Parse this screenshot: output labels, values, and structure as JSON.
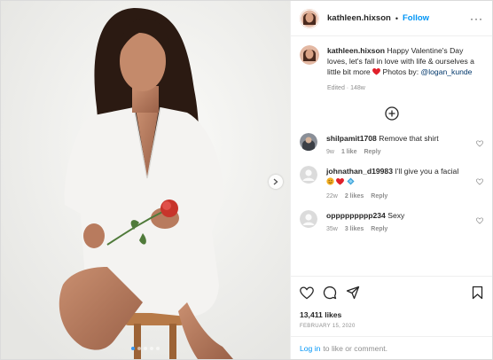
{
  "post": {
    "author": "kathleen.hixson",
    "separator": "•",
    "follow_label": "Follow",
    "more_icon": "more-horizontal-icon",
    "image_count": 5,
    "active_index": 0
  },
  "caption": {
    "author": "kathleen.hixson",
    "text": "Happy Valentine's Day loves, let's fall in love with life & ourselves a little bit more",
    "emoji": "red-heart",
    "photos_by": "Photos by:",
    "mention": "@logan_kunde",
    "meta": "Edited · 148w"
  },
  "comments": [
    {
      "user": "shilpamit1708",
      "text": "Remove that shirt",
      "age": "9w",
      "likes": "1 like",
      "reply": "Reply"
    },
    {
      "user": "johnathan_d19983",
      "text": "I'll give you a facial",
      "emojis": [
        "smiling-face",
        "red-heart",
        "blue-diamond"
      ],
      "age": "22w",
      "likes": "2 likes",
      "reply": "Reply"
    },
    {
      "user": "oppppppppp234",
      "text": "Sexy",
      "age": "35w",
      "likes": "3 likes",
      "reply": "Reply"
    }
  ],
  "stats": {
    "likes": "13,411 likes",
    "date": "FEBRUARY 15, 2020"
  },
  "footer": {
    "login": "Log in",
    "rest": "to like or comment."
  },
  "colors": {
    "accent": "#0095f6",
    "heart": "#ed4956",
    "muted": "#8e8e8e"
  }
}
